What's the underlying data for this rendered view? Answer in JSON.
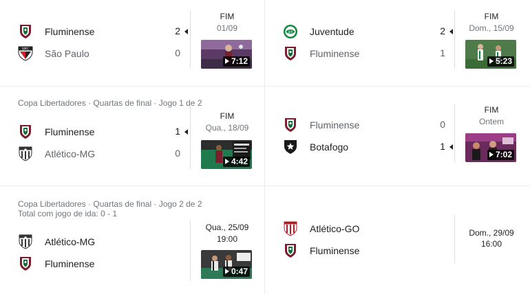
{
  "matches": [
    {
      "header": "",
      "header2": "",
      "home": {
        "name": "Fluminense",
        "score": "2",
        "crest": "fluminense-crest"
      },
      "away": {
        "name": "São Paulo",
        "score": "0",
        "crest": "sao-paulo-crest"
      },
      "status": "FIM",
      "date": "01/09",
      "video": {
        "duration": "7:12"
      }
    },
    {
      "header": "",
      "header2": "",
      "home": {
        "name": "Juventude",
        "score": "2",
        "crest": "juventude-crest"
      },
      "away": {
        "name": "Fluminense",
        "score": "1",
        "crest": "fluminense-crest"
      },
      "status": "FIM",
      "date": "Dom., 15/09",
      "video": {
        "duration": "5:23"
      }
    },
    {
      "header": "Copa Libertadores · Quartas de final · Jogo 1 de 2",
      "header2": "",
      "home": {
        "name": "Fluminense",
        "score": "1",
        "crest": "fluminense-crest"
      },
      "away": {
        "name": "Atlético-MG",
        "score": "0",
        "crest": "atletico-mg-crest"
      },
      "status": "FIM",
      "date": "Qua., 18/09",
      "video": {
        "duration": "4:42"
      }
    },
    {
      "header": "",
      "header2": "",
      "home": {
        "name": "Fluminense",
        "score": "0",
        "crest": "fluminense-crest"
      },
      "away": {
        "name": "Botafogo",
        "score": "1",
        "crest": "botafogo-crest"
      },
      "status": "FIM",
      "date": "Ontem",
      "video": {
        "duration": "7:02"
      }
    },
    {
      "header": "Copa Libertadores · Quartas de final · Jogo 2 de 2",
      "header2": "Total com jogo de ida: 0 - 1",
      "home": {
        "name": "Atlético-MG",
        "score": "",
        "crest": "atletico-mg-crest"
      },
      "away": {
        "name": "Fluminense",
        "score": "",
        "crest": "fluminense-crest"
      },
      "status": "Qua., 25/09",
      "date": "19:00",
      "video": {
        "duration": "0:47"
      }
    },
    {
      "header": "",
      "header2": "",
      "home": {
        "name": "Atlético-GO",
        "score": "",
        "crest": "atletico-go-crest"
      },
      "away": {
        "name": "Fluminense",
        "score": "",
        "crest": "fluminense-crest"
      },
      "status": "Dom., 29/09",
      "date": "16:00",
      "video": null
    }
  ]
}
